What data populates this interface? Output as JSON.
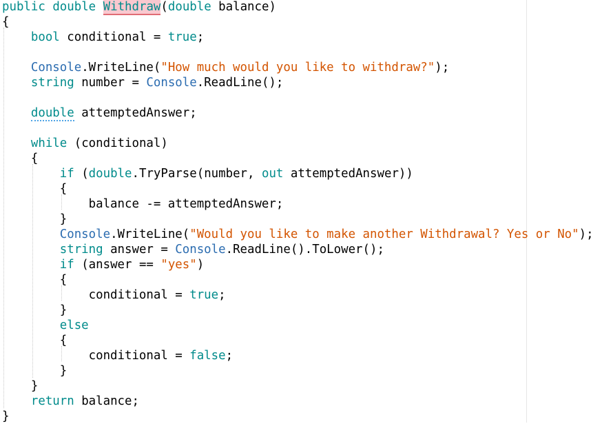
{
  "editor": {
    "lines": [
      [
        {
          "t": "public",
          "c": "kw"
        },
        {
          "t": " ",
          "c": "plain"
        },
        {
          "t": "double",
          "c": "kw"
        },
        {
          "t": " ",
          "c": "plain"
        },
        {
          "t": "Withdraw",
          "c": "kw",
          "d": "error"
        },
        {
          "t": "(",
          "c": "plain"
        },
        {
          "t": "double",
          "c": "kw"
        },
        {
          "t": " balance)",
          "c": "plain"
        }
      ],
      [
        {
          "t": "{",
          "c": "plain"
        }
      ],
      [
        {
          "t": "    ",
          "c": "plain"
        },
        {
          "t": "bool",
          "c": "kw"
        },
        {
          "t": " conditional = ",
          "c": "plain"
        },
        {
          "t": "true",
          "c": "kw"
        },
        {
          "t": ";",
          "c": "plain"
        }
      ],
      [],
      [
        {
          "t": "    ",
          "c": "plain"
        },
        {
          "t": "Console",
          "c": "type"
        },
        {
          "t": ".WriteLine(",
          "c": "plain"
        },
        {
          "t": "\"How much would you like to withdraw?\"",
          "c": "str"
        },
        {
          "t": ");",
          "c": "plain"
        }
      ],
      [
        {
          "t": "    ",
          "c": "plain"
        },
        {
          "t": "string",
          "c": "kw"
        },
        {
          "t": " number = ",
          "c": "plain"
        },
        {
          "t": "Console",
          "c": "type"
        },
        {
          "t": ".ReadLine();",
          "c": "plain"
        }
      ],
      [],
      [
        {
          "t": "    ",
          "c": "plain"
        },
        {
          "t": "double",
          "c": "kw",
          "d": "squiggle"
        },
        {
          "t": " attemptedAnswer;",
          "c": "plain"
        }
      ],
      [],
      [
        {
          "t": "    ",
          "c": "plain"
        },
        {
          "t": "while",
          "c": "kw"
        },
        {
          "t": " (conditional)",
          "c": "plain"
        }
      ],
      [
        {
          "t": "    {",
          "c": "plain"
        }
      ],
      [
        {
          "t": "        ",
          "c": "plain"
        },
        {
          "t": "if",
          "c": "kw"
        },
        {
          "t": " (",
          "c": "plain"
        },
        {
          "t": "double",
          "c": "kw"
        },
        {
          "t": ".TryParse(number, ",
          "c": "plain"
        },
        {
          "t": "out",
          "c": "kw"
        },
        {
          "t": " attemptedAnswer))",
          "c": "plain"
        }
      ],
      [
        {
          "t": "        {",
          "c": "plain"
        }
      ],
      [
        {
          "t": "            balance -= attemptedAnswer;",
          "c": "plain"
        }
      ],
      [
        {
          "t": "        }",
          "c": "plain"
        }
      ],
      [
        {
          "t": "        ",
          "c": "plain"
        },
        {
          "t": "Console",
          "c": "type"
        },
        {
          "t": ".WriteLine(",
          "c": "plain"
        },
        {
          "t": "\"Would you like to make another Withdrawal? Yes or No\"",
          "c": "str"
        },
        {
          "t": ");",
          "c": "plain"
        }
      ],
      [
        {
          "t": "        ",
          "c": "plain"
        },
        {
          "t": "string",
          "c": "kw"
        },
        {
          "t": " answer = ",
          "c": "plain"
        },
        {
          "t": "Console",
          "c": "type"
        },
        {
          "t": ".ReadLine().ToLower();",
          "c": "plain"
        }
      ],
      [
        {
          "t": "        ",
          "c": "plain"
        },
        {
          "t": "if",
          "c": "kw"
        },
        {
          "t": " (answer == ",
          "c": "plain"
        },
        {
          "t": "\"yes\"",
          "c": "str"
        },
        {
          "t": ")",
          "c": "plain"
        }
      ],
      [
        {
          "t": "        {",
          "c": "plain"
        }
      ],
      [
        {
          "t": "            conditional = ",
          "c": "plain"
        },
        {
          "t": "true",
          "c": "kw"
        },
        {
          "t": ";",
          "c": "plain"
        }
      ],
      [
        {
          "t": "        }",
          "c": "plain"
        }
      ],
      [
        {
          "t": "        ",
          "c": "plain"
        },
        {
          "t": "else",
          "c": "kw"
        }
      ],
      [
        {
          "t": "        {",
          "c": "plain"
        }
      ],
      [
        {
          "t": "            conditional = ",
          "c": "plain"
        },
        {
          "t": "false",
          "c": "kw"
        },
        {
          "t": ";",
          "c": "plain"
        }
      ],
      [
        {
          "t": "        }",
          "c": "plain"
        }
      ],
      [
        {
          "t": "    }",
          "c": "plain"
        }
      ],
      [
        {
          "t": "    ",
          "c": "plain"
        },
        {
          "t": "return",
          "c": "kw"
        },
        {
          "t": " balance;",
          "c": "plain"
        }
      ],
      [
        {
          "t": "}",
          "c": "plain"
        }
      ]
    ]
  },
  "colors": {
    "keyword": "#008b8b",
    "type": "#2b6cb0",
    "string": "#d35400",
    "text": "#000000",
    "error_highlight": "#f9c8cf",
    "info_squiggle": "#4ea3e6"
  }
}
